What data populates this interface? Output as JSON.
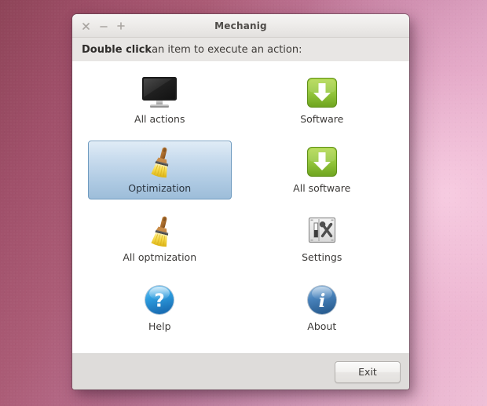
{
  "window": {
    "title": "Mechanig",
    "controls": [
      {
        "name": "close",
        "glyph": "close-icon"
      },
      {
        "name": "minimize",
        "glyph": "minimize-icon"
      },
      {
        "name": "maximize",
        "glyph": "maximize-icon"
      }
    ]
  },
  "instruction": {
    "strong": "Double click",
    "rest": " an item to execute an action:"
  },
  "items": [
    {
      "label": "All actions",
      "icon": "monitor-icon",
      "selected": false
    },
    {
      "label": "Software",
      "icon": "download-green-icon",
      "selected": false
    },
    {
      "label": "Optimization",
      "icon": "broom-icon",
      "selected": true
    },
    {
      "label": "All software",
      "icon": "download-green-icon",
      "selected": false
    },
    {
      "label": "All optmization",
      "icon": "broom-icon",
      "selected": false
    },
    {
      "label": "Settings",
      "icon": "settings-tools-icon",
      "selected": false
    },
    {
      "label": "Help",
      "icon": "help-question-icon",
      "selected": false
    },
    {
      "label": "About",
      "icon": "about-info-icon",
      "selected": false
    }
  ],
  "footer": {
    "exit_label": "Exit"
  },
  "colors": {
    "selection_border": "#6f9bc0",
    "selection_fill_top": "#e0ecf6",
    "selection_fill_bottom": "#9dbdd9",
    "green_icon": "#8cc63f",
    "help_blue": "#3aa3e8",
    "about_blue": "#4d86c0",
    "titlebar": "#eceae8",
    "footer": "#dedcda",
    "content": "#ffffff"
  }
}
